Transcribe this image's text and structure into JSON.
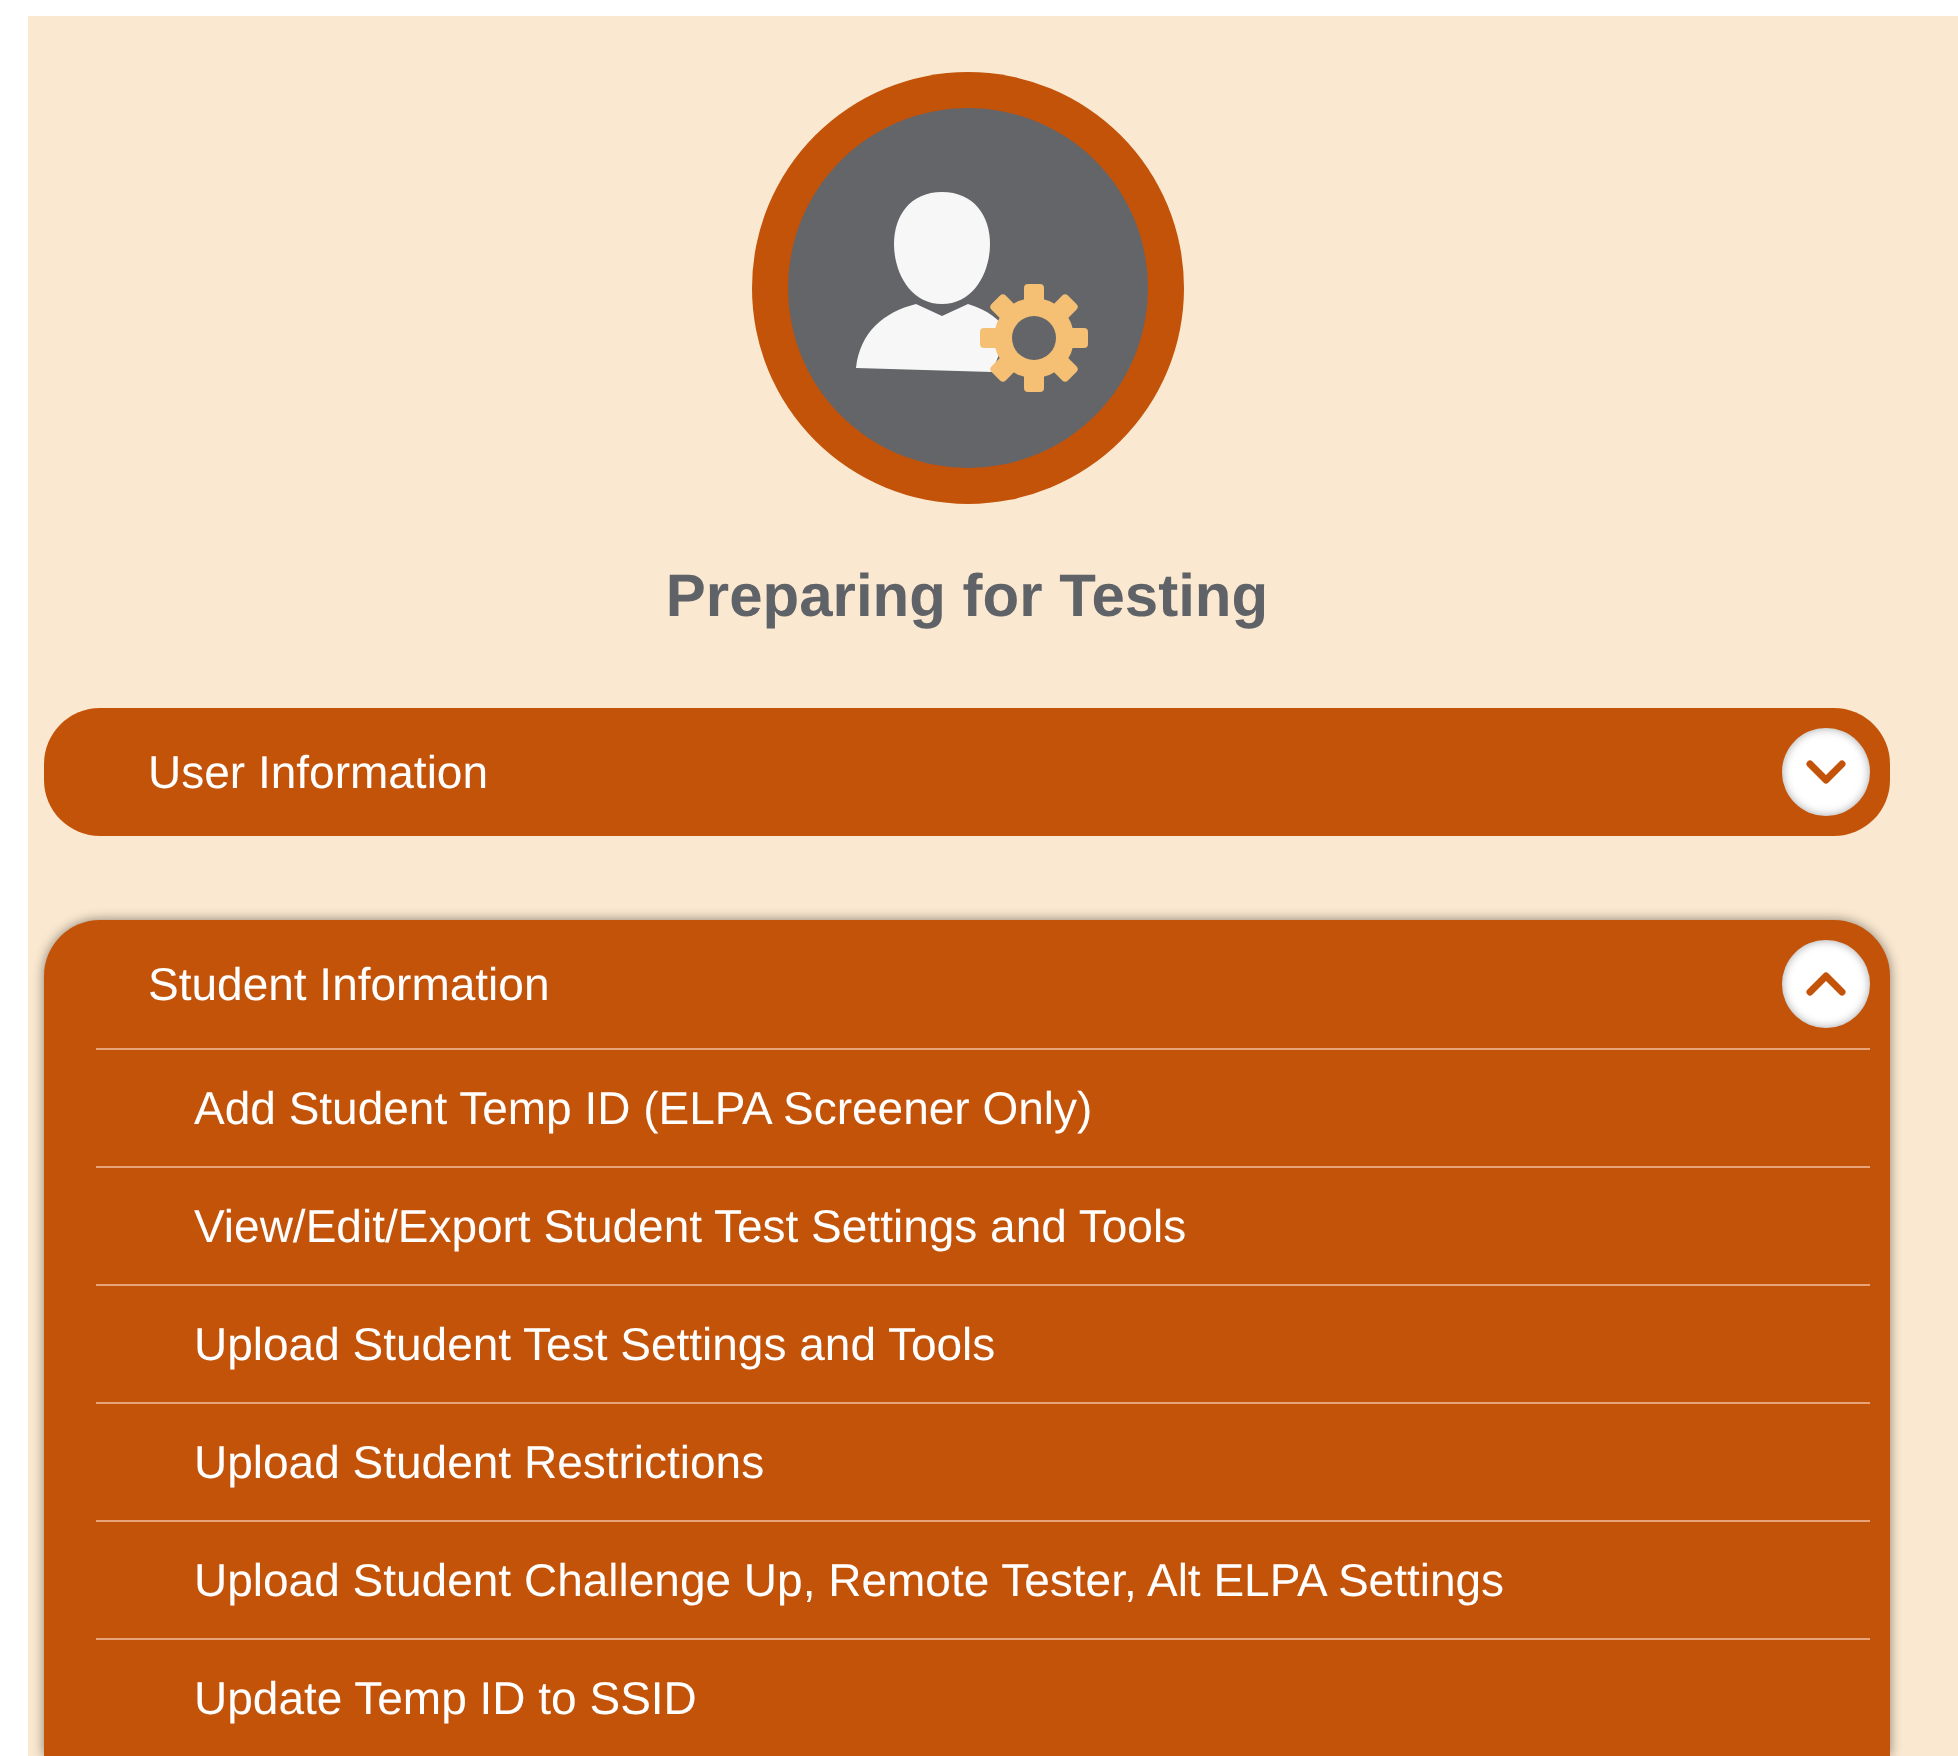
{
  "heading": "Preparing for Testing",
  "sections": [
    {
      "title": "User Information",
      "expanded": false
    },
    {
      "title": "Student Information",
      "expanded": true,
      "items": [
        "Add Student Temp ID (ELPA Screener Only)",
        "View/Edit/Export Student Test Settings and Tools",
        "Upload Student Test Settings and Tools",
        "Upload Student Restrictions",
        "Upload Student Challenge Up, Remote Tester, Alt ELPA Settings",
        "Update Temp ID to SSID"
      ]
    }
  ]
}
